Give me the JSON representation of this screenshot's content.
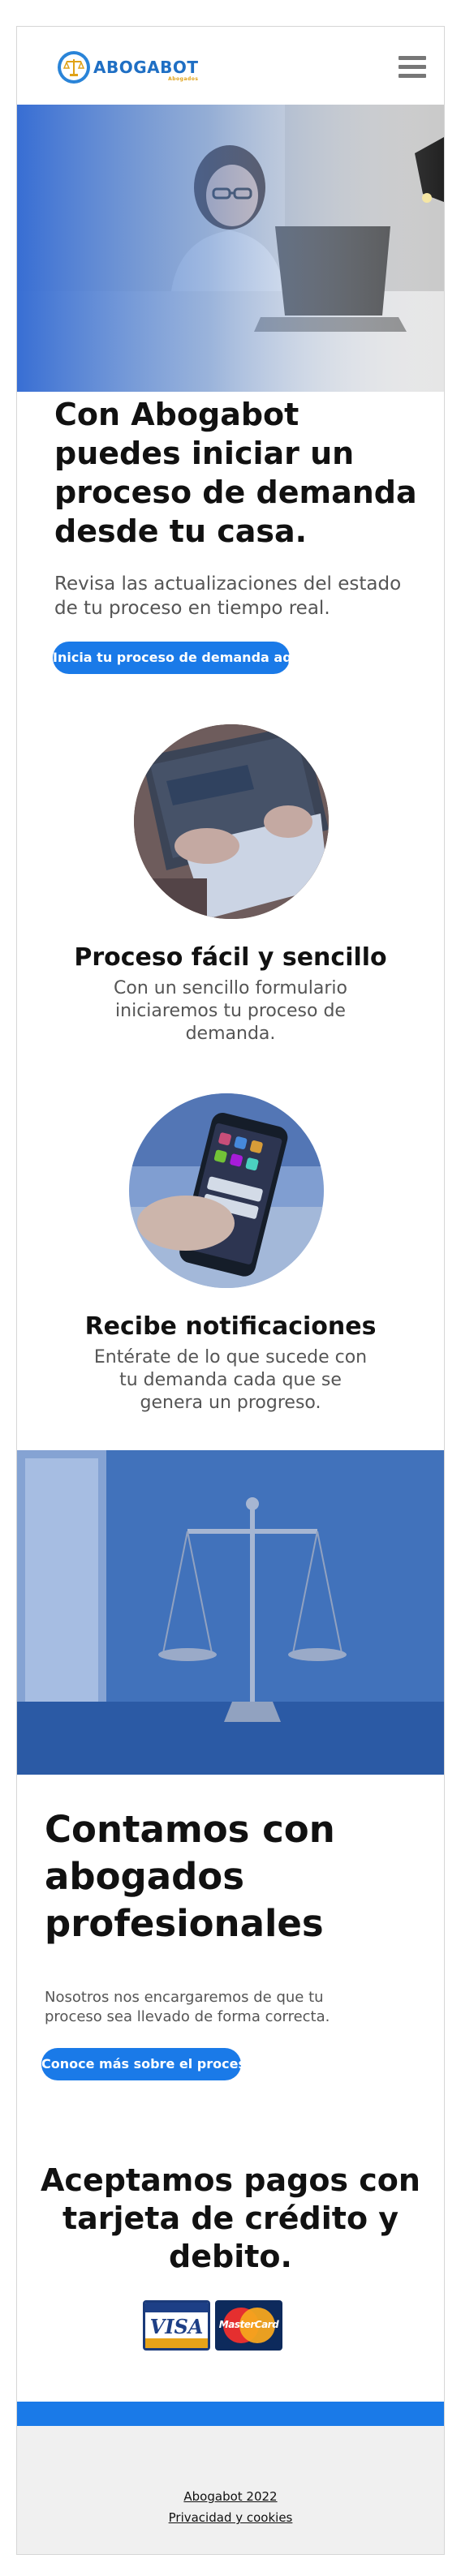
{
  "header": {
    "logo_text": "ABOGABOT",
    "logo_sub": "Abogados"
  },
  "hero": {
    "title": "Con Abogabot puedes iniciar un proceso de demanda desde tu casa.",
    "subtitle": "Revisa las actualizaciones del estado de tu proceso en tiempo real.",
    "button_label": "Inicia tu proceso de demanda aquí"
  },
  "features": [
    {
      "title": "Proceso fácil y sencillo",
      "description": "Con un sencillo formulario iniciaremos tu proceso de demanda."
    },
    {
      "title": "Recibe notificaciones",
      "description": "Entérate de lo que sucede con tu demanda cada que se genera un progreso."
    }
  ],
  "lawyers": {
    "title": "Contamos con abogados profesionales",
    "description": "Nosotros nos encargaremos de que tu proceso sea llevado de forma correcta.",
    "button_label": "Conoce más sobre el proceso"
  },
  "payments": {
    "title": "Aceptamos pagos con tarjeta de crédito y debito.",
    "cards": [
      "VISA",
      "MasterCard"
    ]
  },
  "footer": {
    "copyright": "Abogabot 2022",
    "privacy_link": "Privacidad y cookies"
  },
  "colors": {
    "accent": "#1a7ae8",
    "brand": "#1f6fc4",
    "footer_bg": "#f0f0f0"
  },
  "icons": {
    "menu": "hamburger-menu-icon",
    "logo": "scales-of-justice-icon"
  }
}
